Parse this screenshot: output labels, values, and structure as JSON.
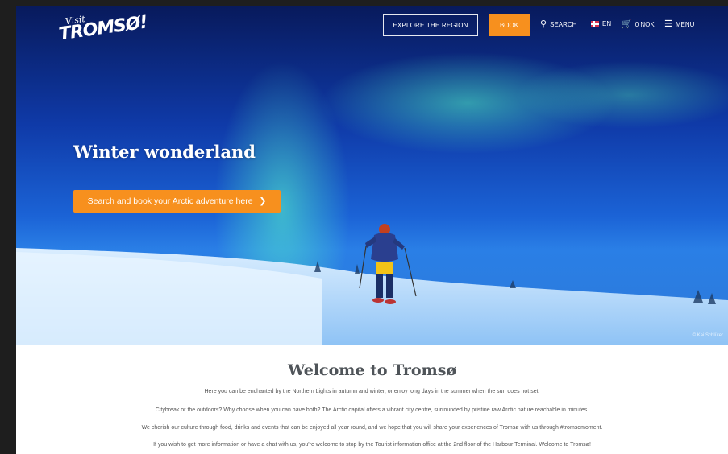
{
  "header": {
    "logo_small": "Visit",
    "logo_big": "TROMSØ!",
    "explore_label": "EXPLORE THE REGION",
    "book_label": "BOOK",
    "search_label": "SEARCH",
    "language_label": "EN",
    "cart_label": "0 NOK",
    "menu_label": "MENU"
  },
  "hero": {
    "title": "Winter wonderland",
    "cta_label": "Search and book your Arctic adventure here",
    "photo_credit": "© Kai Schlüter"
  },
  "welcome": {
    "title": "Welcome to Tromsø",
    "paragraphs": [
      "Here you can be enchanted by the Northern Lights in autumn and winter, or enjoy long days in the summer when the sun does not set.",
      "Citybreak or the outdoors? Why choose when you can have both? The Arctic capital offers a vibrant city centre, surrounded by pristine raw Arctic nature reachable in minutes.",
      "We cherish our culture through food, drinks and events that can be enjoyed all year round, and we hope that you will share your experiences of Tromsø with us through #tromsomoment.",
      "If you wish to get more information or have a chat with us, you're welcome to stop by the Tourist information office at the 2nd floor of the Harbour Terminal. Welcome to Tromsø!"
    ]
  },
  "colors": {
    "accent": "#f7901e",
    "heading": "#4f5459"
  }
}
